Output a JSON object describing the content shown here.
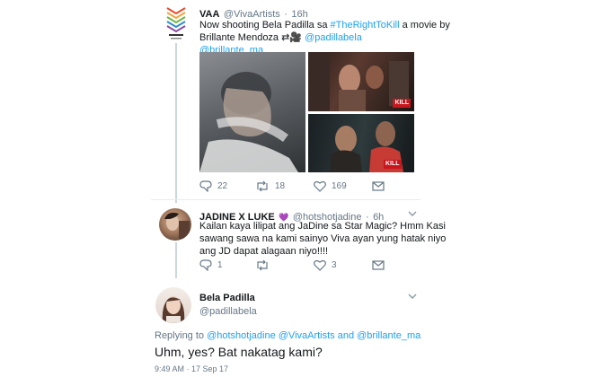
{
  "tweet1": {
    "name": "VAA",
    "handle": "@VivaArtists",
    "sep": "·",
    "time": "16h",
    "line1_a": "Now shooting Bela Padilla  sa ",
    "line1_hashtag": "#TheRightToKill",
    "line1_b": " a movie by",
    "line2_a": "Brillante Mendoza ",
    "line2_emoji": "⇄🎥",
    "line2_mention": " @padillabela",
    "line3_mention": "@brillante_ma",
    "badge1": "KILL",
    "badge2": "KILL",
    "actions": {
      "replies": "22",
      "retweets": "18",
      "likes": "169"
    }
  },
  "tweet2": {
    "name": "JADINE X LUKE",
    "heart": "💜",
    "handle": "@hotshotjadine",
    "sep": "·",
    "time": "6h",
    "line1": "Kailan kaya lilipat ang JaDine sa Star Magic? Hmm Kasi",
    "line2": "sawang sawa na kami sainyo Viva ayan yung hatak niyo",
    "line3": "ang JD dapat alagaan niyo!!!!",
    "actions": {
      "replies": "1",
      "retweets": "",
      "likes": "3"
    }
  },
  "tweet3": {
    "name": "Bela Padilla",
    "handle": "@padillabela",
    "replying_prefix": "Replying to ",
    "replying_users": "@hotshotjadine @VivaArtists and @brillante_ma",
    "text": "Uhm, yes? Bat nakatag kami?",
    "timestamp": "9:49 AM · 17 Sep 17"
  },
  "icons": [
    "viva-logo",
    "avatar",
    "reply-icon",
    "retweet-icon",
    "like-icon",
    "mail-icon",
    "chevron-down-icon"
  ],
  "colors": {
    "link": "#1da1f2",
    "muted": "#657786",
    "divider": "#e6ecf0",
    "badge": "#c8161d"
  }
}
